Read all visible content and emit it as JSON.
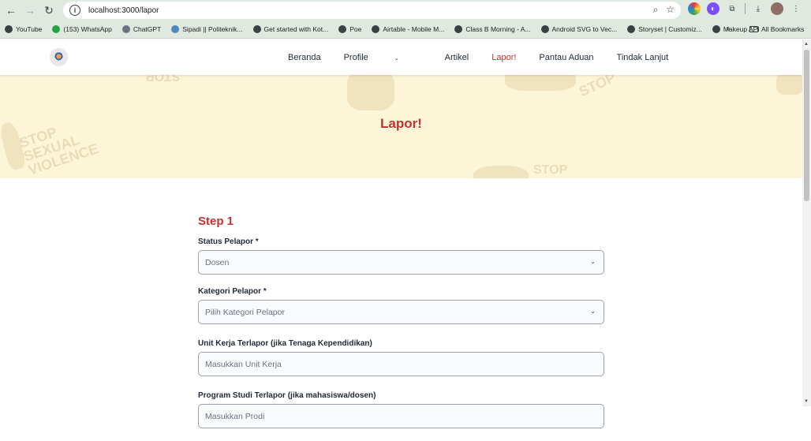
{
  "browser": {
    "url": "localhost:3000/lapor",
    "bookmarks": [
      "YouTube",
      "(153) WhatsApp",
      "ChatGPT",
      "Sipadi || Politeknik...",
      "Get started with Kot...",
      "Poe",
      "Airtable - Mobile M...",
      "Class B Morning - A...",
      "Android SVG to Vec...",
      "Storyset | Customiz...",
      "Makeup API"
    ],
    "all_bookmarks": "All Bookmarks",
    "more": "»"
  },
  "nav": {
    "items": [
      "Beranda",
      "Profile",
      "Artikel",
      "Lapor!",
      "Pantau Aduan",
      "Tindak Lanjut"
    ],
    "active_index": 3
  },
  "hero": {
    "title": "Lapor!",
    "watermark_1": "STOP SEXUAL VIOLENCE",
    "watermark_2": "STOP"
  },
  "form": {
    "step": "Step 1",
    "fields": [
      {
        "label": "Status Pelapor *",
        "value": "Dosen",
        "type": "select"
      },
      {
        "label": "Kategori Pelapor *",
        "placeholder": "Pilih Kategori Pelapor",
        "type": "select"
      },
      {
        "label": "Unit Kerja Terlapor (jika Tenaga Kependidikan)",
        "placeholder": "Masukkan Unit Kerja",
        "type": "text"
      },
      {
        "label": "Program Studi Terlapor (jika mahasiswa/dosen)",
        "placeholder": "Masukkan Prodi",
        "type": "text"
      }
    ]
  },
  "colors": {
    "accent": "#c53030",
    "hero_bg": "#fdf5d8",
    "chrome_bg": "#dfe9df"
  }
}
